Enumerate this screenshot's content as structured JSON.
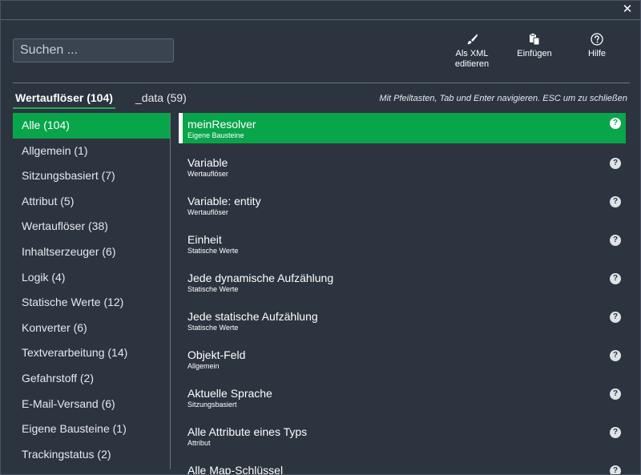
{
  "search": {
    "placeholder": "Suchen ..."
  },
  "toolbar": {
    "xml_line1": "Als XML",
    "xml_line2": "editieren",
    "insert_label": "Einfügen",
    "help_label": "Hilfe"
  },
  "tabs": [
    {
      "label": "Wertauflöser (104)",
      "active": true
    },
    {
      "label": "_data (59)",
      "active": false
    }
  ],
  "hint": "Mit Pfeiltasten, Tab und Enter navigieren. ESC um zu schließen",
  "categories": [
    "Alle (104)",
    "Allgemein (1)",
    "Sitzungsbasiert (7)",
    "Attribut (5)",
    "Wertauflöser (38)",
    "Inhaltserzeuger (6)",
    "Logik (4)",
    "Statische Werte (12)",
    "Konverter (6)",
    "Textverarbeitung (14)",
    "Gefahrstoff (2)",
    "E-Mail-Versand (6)",
    "Eigene Bausteine (1)",
    "Trackingstatus (2)"
  ],
  "items": [
    {
      "name": "meinResolver",
      "sub": "Eigene Bausteine"
    },
    {
      "name": "Variable",
      "sub": "Wertauflöser"
    },
    {
      "name": "Variable: entity",
      "sub": "Wertauflöser"
    },
    {
      "name": "Einheit",
      "sub": "Statische Werte"
    },
    {
      "name": "Jede dynamische Aufzählung",
      "sub": "Statische Werte"
    },
    {
      "name": "Jede statische Aufzählung",
      "sub": "Statische Werte"
    },
    {
      "name": "Objekt-Feld",
      "sub": "Allgemein"
    },
    {
      "name": "Aktuelle Sprache",
      "sub": "Sitzungsbasiert"
    },
    {
      "name": "Alle Attribute eines Typs",
      "sub": "Attribut"
    },
    {
      "name": "Alle Map-Schlüssel",
      "sub": ""
    }
  ],
  "icons": {
    "close": "close-icon",
    "xml": "brush-icon",
    "insert": "paste-icon",
    "help": "question-circle-icon"
  },
  "colors": {
    "background": "#2c3440",
    "accent": "#09a54a"
  }
}
